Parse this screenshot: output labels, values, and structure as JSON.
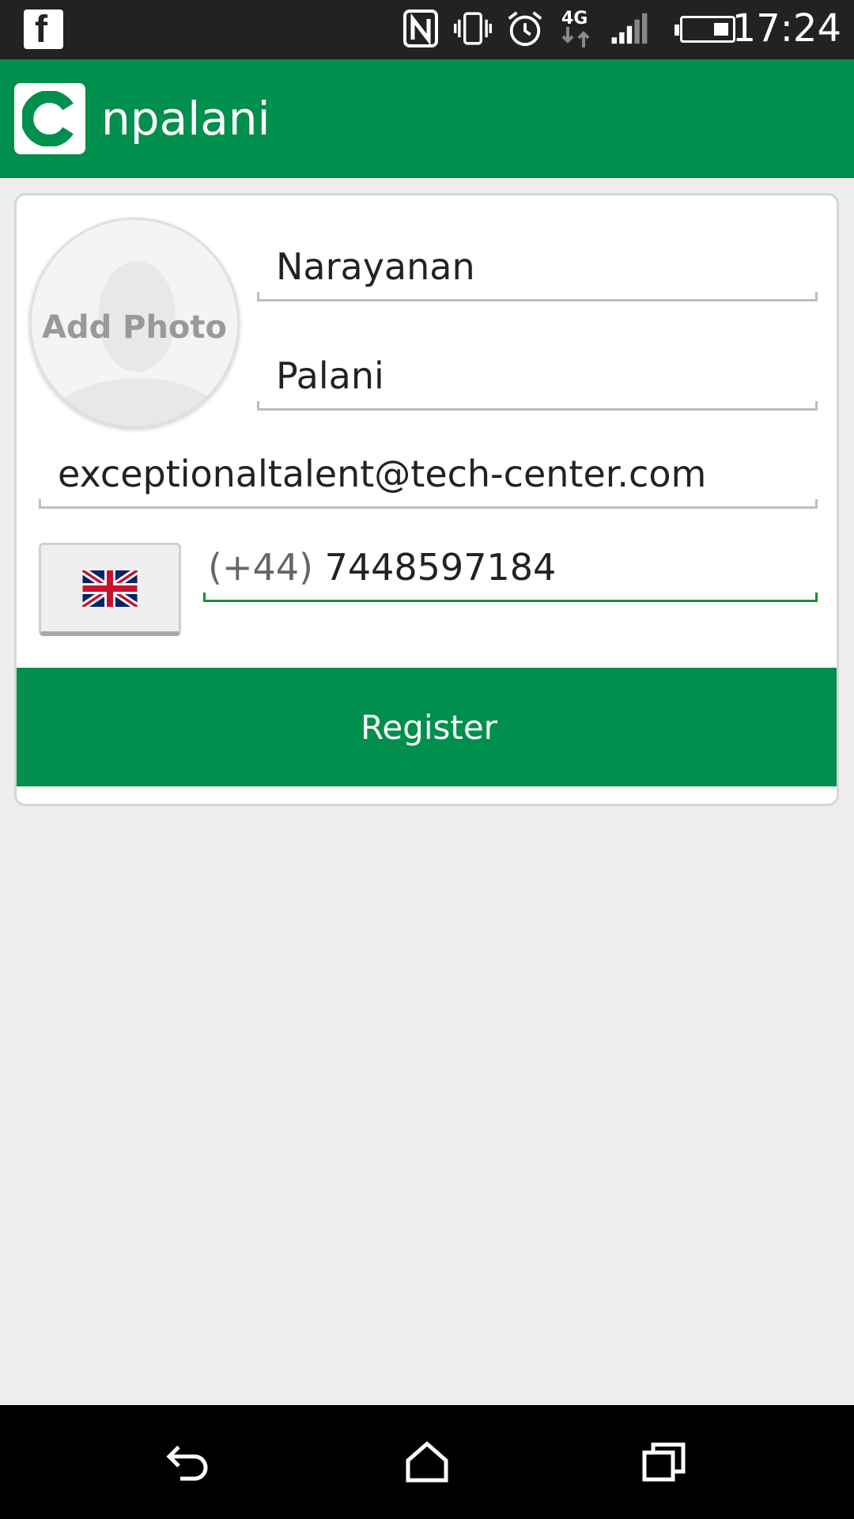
{
  "status_bar": {
    "time": "17:24",
    "left_icon": "facebook-icon",
    "icons": [
      "nfc-icon",
      "vibrate-icon",
      "alarm-icon",
      "4g-icon",
      "signal-icon",
      "battery-icon"
    ]
  },
  "app_bar": {
    "title": "npalani",
    "logo_letter": "C",
    "color": "#008f4c"
  },
  "form": {
    "photo_label": "Add Photo",
    "first_name": "Narayanan",
    "last_name": "Palani",
    "email": "exceptionaltalent@tech-center.com",
    "phone_prefix": "(+44)",
    "phone_number": "7448597184",
    "country_icon": "uk-flag-icon",
    "register_label": "Register"
  },
  "nav_bar": {
    "buttons": [
      "back-icon",
      "home-icon",
      "recents-icon"
    ]
  }
}
